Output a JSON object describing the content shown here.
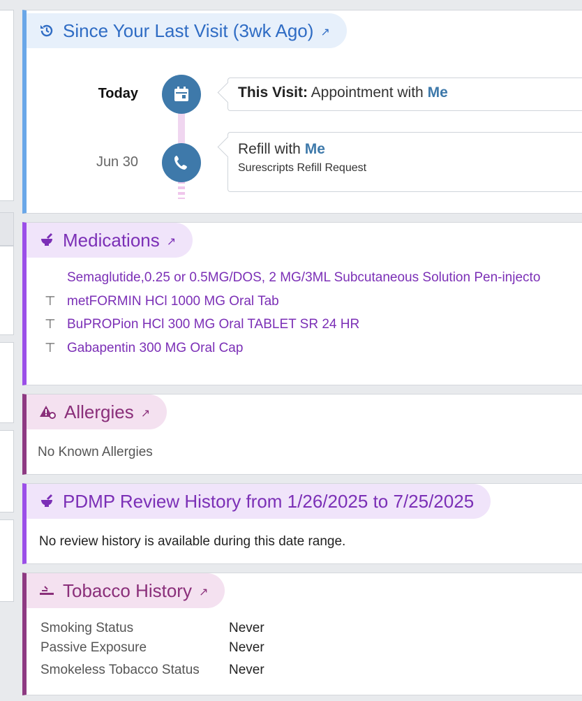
{
  "visit": {
    "title": "Since Your Last Visit (3wk Ago)",
    "events": [
      {
        "date": "Today",
        "title_prefix": "This Visit:",
        "title_rest": " Appointment with ",
        "who": "Me",
        "sub": ""
      },
      {
        "date": "Jun 30",
        "title_prefix": "",
        "title_rest": "Refill with ",
        "who": "Me",
        "sub": "Surescripts Refill Request"
      }
    ]
  },
  "medications": {
    "title": "Medications",
    "items": [
      "Semaglutide,0.25 or 0.5MG/DOS, 2 MG/3ML Subcutaneous Solution Pen-injecto",
      "metFORMIN HCl 1000 MG Oral Tab",
      "BuPROPion HCl 300 MG Oral TABLET SR 24 HR",
      "Gabapentin 300 MG Oral Cap"
    ]
  },
  "allergies": {
    "title": "Allergies",
    "text": "No Known Allergies"
  },
  "pdmp": {
    "title": "PDMP Review History from 1/26/2025 to 7/25/2025",
    "text": "No review history is available during this date range."
  },
  "tobacco": {
    "title": "Tobacco History",
    "rows": [
      {
        "label": "Smoking Status",
        "value": "Never"
      },
      {
        "label": "Passive Exposure",
        "value": "Never"
      },
      {
        "label": "Smokeless Tobacco Status",
        "value": "Never"
      }
    ]
  },
  "icons": {
    "visit": "history-icon",
    "medications": "mortar-pestle-icon",
    "allergies": "allergy-icon",
    "pdmp": "mortar-pestle-icon",
    "tobacco": "cigarette-icon",
    "external": "external-link-icon",
    "pin": "pin-icon",
    "calendar": "calendar-icon",
    "phone": "phone-icon"
  },
  "colors": {
    "visit_accent": "#2f6cc4",
    "medication_accent": "#7b2fb6",
    "allergy_accent": "#8a2f7a",
    "timeline_dot": "#3e79aa"
  }
}
